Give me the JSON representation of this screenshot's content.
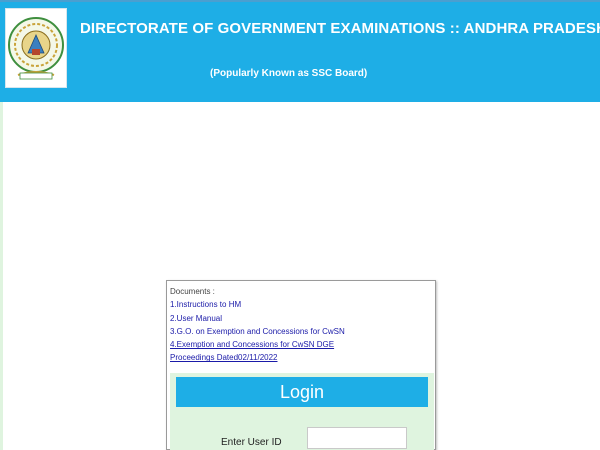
{
  "header": {
    "title": "DIRECTORATE OF GOVERNMENT EXAMINATIONS :: ANDHRA PRADESH",
    "subtitle": "(Popularly Known as SSC Board)",
    "logo_icon": "andhra-pradesh-emblem-icon"
  },
  "documents": {
    "title": "Documents :",
    "items": [
      {
        "label": "1.Instructions to HM"
      },
      {
        "label": "2.User Manual"
      },
      {
        "label": "3.G.O. on Exemption and Concessions for CwSN"
      },
      {
        "label": "4.Exemption and Concessions for CwSN DGE"
      },
      {
        "label": "Proceedings Dated02/11/2022"
      }
    ]
  },
  "login": {
    "heading": "Login",
    "user_id_label": "Enter User ID",
    "user_id_value": ""
  },
  "colors": {
    "header_bg": "#1eaee6",
    "login_bg": "#dff4df",
    "link": "#1a1aa8"
  }
}
